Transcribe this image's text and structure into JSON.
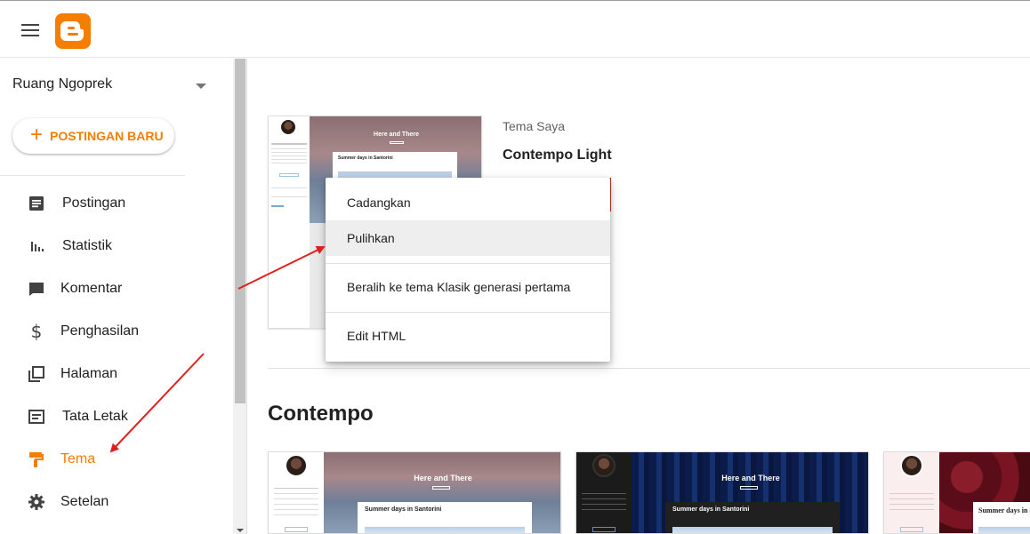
{
  "header": {
    "menu_icon": "hamburger-menu-icon",
    "logo_icon": "blogger-logo-icon"
  },
  "sidebar": {
    "blog_name": "Ruang Ngoprek",
    "new_post_label": "POSTINGAN BARU",
    "items": [
      {
        "label": "Postingan",
        "icon": "posts-icon"
      },
      {
        "label": "Statistik",
        "icon": "stats-icon"
      },
      {
        "label": "Komentar",
        "icon": "comment-icon"
      },
      {
        "label": "Penghasilan",
        "icon": "dollar-icon"
      },
      {
        "label": "Halaman",
        "icon": "pages-icon"
      },
      {
        "label": "Tata Letak",
        "icon": "layout-icon"
      },
      {
        "label": "Tema",
        "icon": "paint-roller-icon",
        "active": true
      },
      {
        "label": "Setelan",
        "icon": "gear-icon"
      }
    ]
  },
  "my_theme": {
    "section_label": "Tema Saya",
    "name": "Contempo Light"
  },
  "menu": {
    "items": [
      "Cadangkan",
      "Pulihkan",
      "Beralih ke tema Klasik generasi pertama",
      "Edit HTML"
    ]
  },
  "gallery": {
    "title": "Contempo"
  },
  "thumbs": {
    "blog_title": "Here and There",
    "post_title": "Summer days in Santorini",
    "author": "ALEXANDRA HOME"
  },
  "colors": {
    "accent": "#f57d00",
    "annotation_arrow": "#e0201b"
  }
}
